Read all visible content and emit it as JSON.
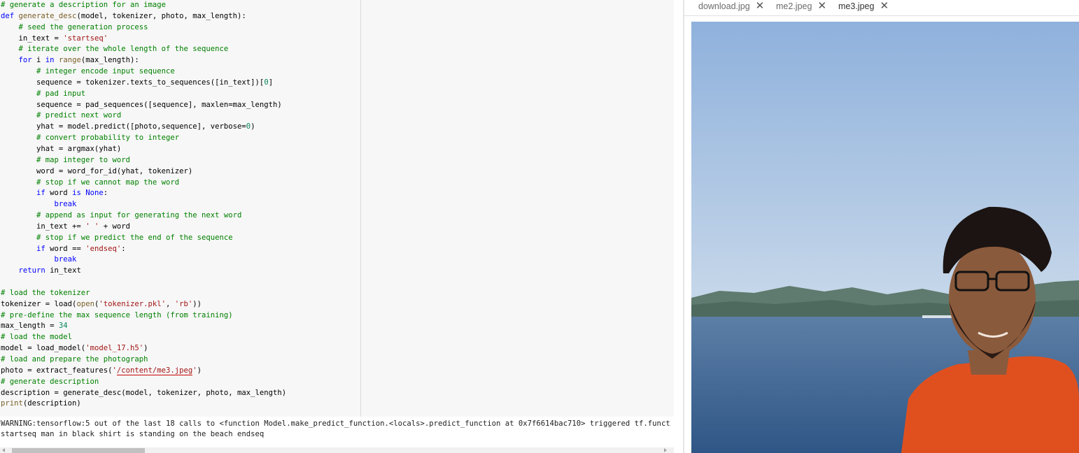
{
  "editor": {
    "code_lines": [
      [
        {
          "t": "# generate a description for an image",
          "c": "comment"
        }
      ],
      [
        {
          "t": "def ",
          "c": "keyword"
        },
        {
          "t": "generate_desc",
          "c": "func"
        },
        {
          "t": "(model, tokenizer, photo, max_length):",
          "c": "plain"
        }
      ],
      [
        {
          "t": "    # seed the generation process",
          "c": "comment"
        }
      ],
      [
        {
          "t": "    in_text = ",
          "c": "plain"
        },
        {
          "t": "'startseq'",
          "c": "string"
        }
      ],
      [
        {
          "t": "    # iterate over the whole length of the sequence",
          "c": "comment"
        }
      ],
      [
        {
          "t": "    ",
          "c": "plain"
        },
        {
          "t": "for",
          "c": "keyword"
        },
        {
          "t": " i ",
          "c": "plain"
        },
        {
          "t": "in",
          "c": "keyword"
        },
        {
          "t": " ",
          "c": "plain"
        },
        {
          "t": "range",
          "c": "builtin"
        },
        {
          "t": "(max_length):",
          "c": "plain"
        }
      ],
      [
        {
          "t": "        # integer encode input sequence",
          "c": "comment"
        }
      ],
      [
        {
          "t": "        sequence = tokenizer.texts_to_sequences([in_text])[",
          "c": "plain"
        },
        {
          "t": "0",
          "c": "number"
        },
        {
          "t": "]",
          "c": "plain"
        }
      ],
      [
        {
          "t": "        # pad input",
          "c": "comment"
        }
      ],
      [
        {
          "t": "        sequence = pad_sequences([sequence], maxlen=max_length)",
          "c": "plain"
        }
      ],
      [
        {
          "t": "        # predict next word",
          "c": "comment"
        }
      ],
      [
        {
          "t": "        yhat = model.predict([photo,sequence], verbose=",
          "c": "plain"
        },
        {
          "t": "0",
          "c": "number"
        },
        {
          "t": ")",
          "c": "plain"
        }
      ],
      [
        {
          "t": "        # convert probability to integer",
          "c": "comment"
        }
      ],
      [
        {
          "t": "        yhat = argmax(yhat)",
          "c": "plain"
        }
      ],
      [
        {
          "t": "        # map integer to word",
          "c": "comment"
        }
      ],
      [
        {
          "t": "        word = word_for_id(yhat, tokenizer)",
          "c": "plain"
        }
      ],
      [
        {
          "t": "        # stop if we cannot map the word",
          "c": "comment"
        }
      ],
      [
        {
          "t": "        ",
          "c": "plain"
        },
        {
          "t": "if",
          "c": "keyword"
        },
        {
          "t": " word ",
          "c": "plain"
        },
        {
          "t": "is",
          "c": "keyword"
        },
        {
          "t": " ",
          "c": "plain"
        },
        {
          "t": "None",
          "c": "keyword"
        },
        {
          "t": ":",
          "c": "plain"
        }
      ],
      [
        {
          "t": "            ",
          "c": "plain"
        },
        {
          "t": "break",
          "c": "keyword"
        }
      ],
      [
        {
          "t": "        # append as input for generating the next word",
          "c": "comment"
        }
      ],
      [
        {
          "t": "        in_text += ",
          "c": "plain"
        },
        {
          "t": "' '",
          "c": "string"
        },
        {
          "t": " + word",
          "c": "plain"
        }
      ],
      [
        {
          "t": "        # stop if we predict the end of the sequence",
          "c": "comment"
        }
      ],
      [
        {
          "t": "        ",
          "c": "plain"
        },
        {
          "t": "if",
          "c": "keyword"
        },
        {
          "t": " word == ",
          "c": "plain"
        },
        {
          "t": "'endseq'",
          "c": "string"
        },
        {
          "t": ":",
          "c": "plain"
        }
      ],
      [
        {
          "t": "            ",
          "c": "plain"
        },
        {
          "t": "break",
          "c": "keyword"
        }
      ],
      [
        {
          "t": "    ",
          "c": "plain"
        },
        {
          "t": "return",
          "c": "keyword"
        },
        {
          "t": " in_text",
          "c": "plain"
        }
      ],
      [],
      [
        {
          "t": "# load the tokenizer",
          "c": "comment"
        }
      ],
      [
        {
          "t": "tokenizer = load(",
          "c": "plain"
        },
        {
          "t": "open",
          "c": "builtin"
        },
        {
          "t": "(",
          "c": "plain"
        },
        {
          "t": "'tokenizer.pkl'",
          "c": "string"
        },
        {
          "t": ", ",
          "c": "plain"
        },
        {
          "t": "'rb'",
          "c": "string"
        },
        {
          "t": "))",
          "c": "plain"
        }
      ],
      [
        {
          "t": "# pre-define the max sequence length (from training)",
          "c": "comment"
        }
      ],
      [
        {
          "t": "max_length = ",
          "c": "plain"
        },
        {
          "t": "34",
          "c": "number"
        }
      ],
      [
        {
          "t": "# load the model",
          "c": "comment"
        }
      ],
      [
        {
          "t": "model = load_model(",
          "c": "plain"
        },
        {
          "t": "'model_17.h5'",
          "c": "string"
        },
        {
          "t": ")",
          "c": "plain"
        }
      ],
      [
        {
          "t": "# load and prepare the photograph",
          "c": "comment"
        }
      ],
      [
        {
          "t": "photo = extract_features(",
          "c": "plain"
        },
        {
          "t": "'",
          "c": "string"
        },
        {
          "t": "/content/me3.jpeg",
          "c": "string",
          "u": true
        },
        {
          "t": "'",
          "c": "string"
        },
        {
          "t": ")",
          "c": "plain"
        }
      ],
      [
        {
          "t": "# generate description",
          "c": "comment"
        }
      ],
      [
        {
          "t": "description = generate_desc(model, tokenizer, photo, max_length)",
          "c": "plain"
        }
      ],
      [
        {
          "t": "print",
          "c": "builtin"
        },
        {
          "t": "(description)",
          "c": "plain"
        }
      ]
    ]
  },
  "output": {
    "lines": [
      "WARNING:tensorflow:5 out of the last 18 calls to <function Model.make_predict_function.<locals>.predict_function at 0x7f6614bac710> triggered tf.funct",
      "startseq man in black shirt is standing on the beach endseq"
    ]
  },
  "viewer": {
    "tabs": [
      {
        "label": "download.jpg",
        "active": false,
        "close_icon": "close-icon"
      },
      {
        "label": "me2.jpeg",
        "active": false,
        "close_icon": "close-icon"
      },
      {
        "label": "me3.jpeg",
        "active": true,
        "close_icon": "close-icon"
      }
    ],
    "photo": {
      "subject": "photo-of-man-in-orange-shirt-by-sea",
      "colors": {
        "sky": "#a9c6e6",
        "sea": "#466d9c",
        "hills": "#5f7a6e",
        "shirt": "#e0501f",
        "skin": "#8a5a3c",
        "hair": "#1b1412"
      }
    }
  }
}
